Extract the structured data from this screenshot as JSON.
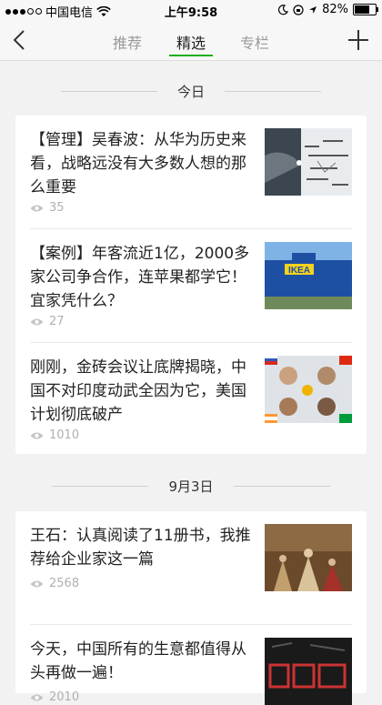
{
  "status_bar": {
    "carrier": "中国电信",
    "time": "上午9:58",
    "battery": "82%",
    "battery_level": 0.82
  },
  "nav": {
    "tabs": [
      {
        "label": "推荐",
        "active": false
      },
      {
        "label": "精选",
        "active": true
      },
      {
        "label": "专栏",
        "active": false
      }
    ],
    "accent_color": "#1aad19"
  },
  "sections": [
    {
      "date": "今日",
      "articles": [
        {
          "title": "【管理】吴春波：从华为历史来看，战略远没有大多数人想的那么重要",
          "views": "35",
          "thumb": "hand-drawing-diagram-image"
        },
        {
          "title": "【案例】年客流近1亿，2000多家公司争合作，连苹果都学它！宜家凭什么？",
          "views": "27",
          "thumb": "ikea-store-image"
        },
        {
          "title": "刚刚，金砖会议让底牌揭晓，中国不对印度动武全因为它，美国计划彻底破产",
          "views": "1010",
          "thumb": "brics-leaders-image"
        }
      ]
    },
    {
      "date": "9月3日",
      "articles": [
        {
          "title": "王石：认真阅读了11册书，我推荐给企业家这一篇",
          "views": "2568",
          "thumb": "classical-painting-image"
        },
        {
          "title": "今天，中国所有的生意都值得从头再做一遍！",
          "views": "2010",
          "thumb": "dark-poster-image"
        }
      ]
    }
  ]
}
